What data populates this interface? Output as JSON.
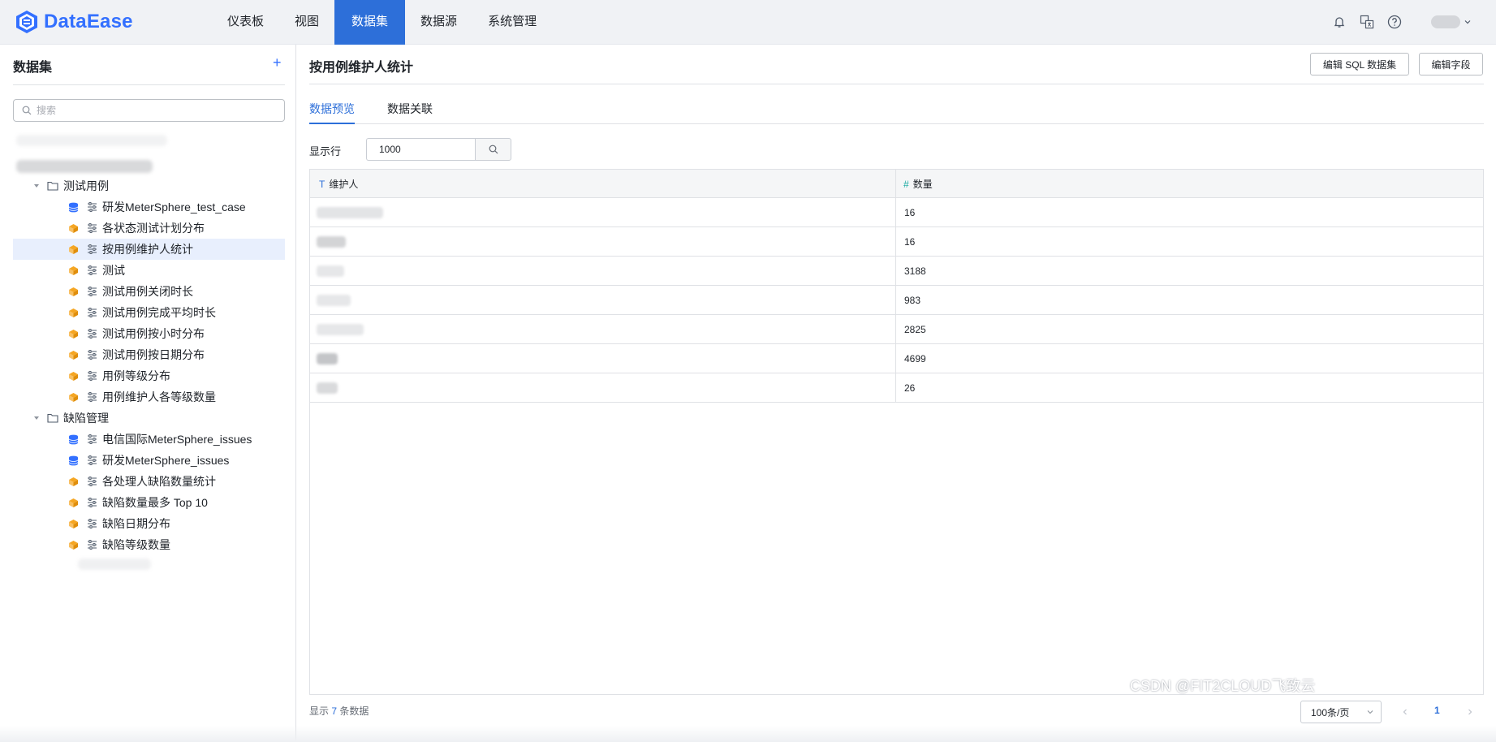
{
  "app": {
    "name": "DataEase"
  },
  "nav": {
    "items": [
      {
        "label": "仪表板"
      },
      {
        "label": "视图"
      },
      {
        "label": "数据集"
      },
      {
        "label": "数据源"
      },
      {
        "label": "系统管理"
      }
    ],
    "active": "数据集"
  },
  "topbar_icons": [
    "bell-icon",
    "translate-icon",
    "help-icon",
    "user-avatar",
    "chevron-down-icon"
  ],
  "sidebar": {
    "title": "数据集",
    "add_icon": "plus-icon",
    "search_placeholder": "搜索",
    "tree": [
      {
        "label": "测试用例",
        "type": "folder",
        "expanded": true
      },
      {
        "label": "研发MeterSphere_test_case",
        "type": "db"
      },
      {
        "label": "各状态测试计划分布",
        "type": "sql"
      },
      {
        "label": "按用例维护人统计",
        "type": "sql",
        "selected": true
      },
      {
        "label": "测试",
        "type": "sql"
      },
      {
        "label": "测试用例关闭时长",
        "type": "sql"
      },
      {
        "label": "测试用例完成平均时长",
        "type": "sql"
      },
      {
        "label": "测试用例按小时分布",
        "type": "sql"
      },
      {
        "label": "测试用例按日期分布",
        "type": "sql"
      },
      {
        "label": "用例等级分布",
        "type": "sql"
      },
      {
        "label": "用例维护人各等级数量",
        "type": "sql"
      },
      {
        "label": "缺陷管理",
        "type": "folder",
        "expanded": true
      },
      {
        "label": "电信国际MeterSphere_issues",
        "type": "db"
      },
      {
        "label": "研发MeterSphere_issues",
        "type": "db"
      },
      {
        "label": "各处理人缺陷数量统计",
        "type": "sql"
      },
      {
        "label": "缺陷数量最多 Top 10",
        "type": "sql"
      },
      {
        "label": "缺陷日期分布",
        "type": "sql"
      },
      {
        "label": "缺陷等级数量",
        "type": "sql"
      }
    ]
  },
  "main": {
    "title": "按用例维护人统计",
    "buttons": {
      "edit_sql": "编辑 SQL 数据集",
      "edit_field": "编辑字段"
    },
    "tabs": [
      {
        "label": "数据预览"
      },
      {
        "label": "数据关联"
      }
    ],
    "active_tab": "数据预览",
    "rows_label": "显示行",
    "rows_value": "1000",
    "table": {
      "columns": [
        {
          "type_icon": "T",
          "label": "维护人"
        },
        {
          "type_icon": "#",
          "label": "数量"
        }
      ],
      "rows": [
        {
          "count": "16"
        },
        {
          "count": "16"
        },
        {
          "count": "3188"
        },
        {
          "count": "983"
        },
        {
          "count": "2825"
        },
        {
          "count": "4699"
        },
        {
          "count": "26"
        }
      ]
    },
    "footer": {
      "prefix": "显示",
      "count": "7",
      "suffix": "条数据"
    },
    "pagination": {
      "page_size": "100条/页",
      "current_page": "1"
    }
  },
  "watermark": "CSDN @FIT2CLOUD飞致云",
  "colors": {
    "accent": "#2d6fd9",
    "brand": "#3370ff",
    "db_icon": "#3370ff",
    "sql_icon": "#f5a623"
  }
}
